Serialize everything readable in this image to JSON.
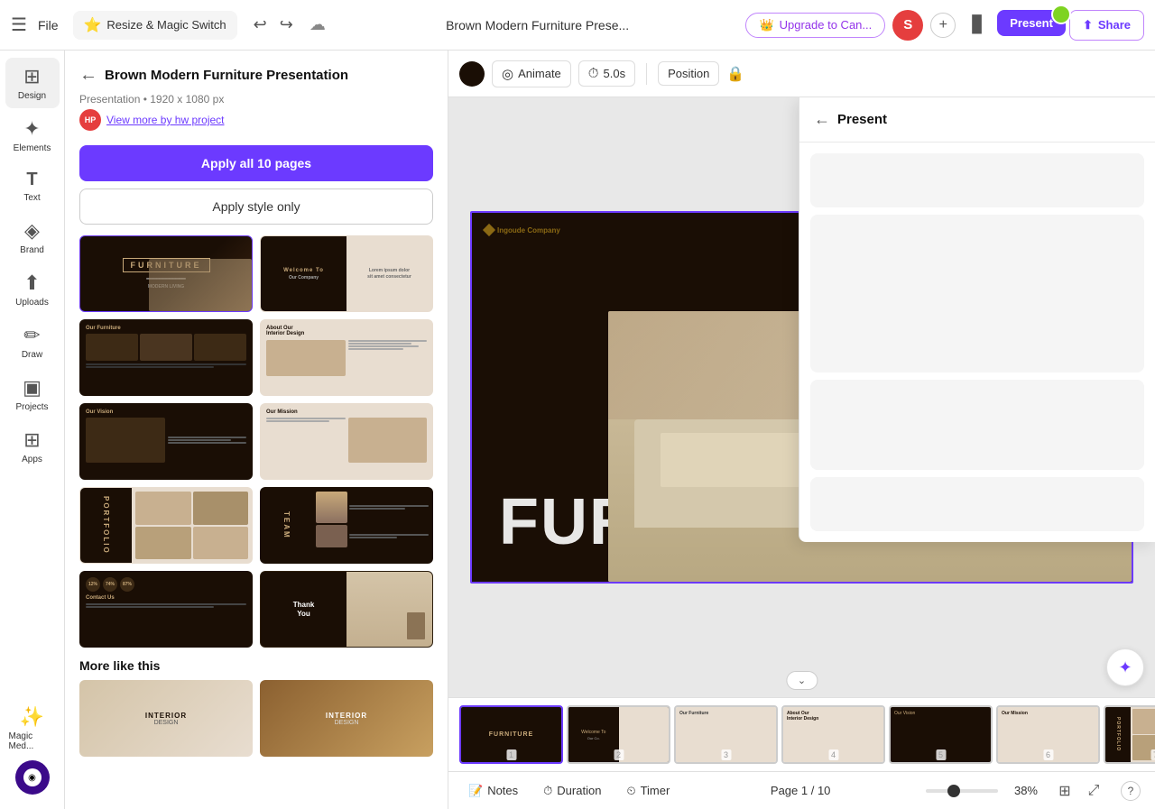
{
  "topbar": {
    "menu_icon": "☰",
    "file_label": "File",
    "magic_switch_icon": "⭐",
    "magic_switch_label": "Resize & Magic Switch",
    "undo_icon": "↩",
    "redo_icon": "↪",
    "cloud_icon": "☁",
    "title": "Brown Modern Furniture Prese...",
    "upgrade_icon": "👑",
    "upgrade_label": "Upgrade to Can...",
    "avatar_label": "S",
    "plus_label": "+",
    "bars_icon": "▊",
    "present_label": "Present",
    "share_icon": "⬆",
    "share_label": "Share"
  },
  "sidebar": {
    "items": [
      {
        "icon": "⊞",
        "label": "Design"
      },
      {
        "icon": "✦",
        "label": "Elements"
      },
      {
        "icon": "T",
        "label": "Text"
      },
      {
        "icon": "◈",
        "label": "Brand"
      },
      {
        "icon": "⬆",
        "label": "Uploads"
      },
      {
        "icon": "✏",
        "label": "Draw"
      },
      {
        "icon": "▣",
        "label": "Projects"
      },
      {
        "icon": "⊞",
        "label": "Apps"
      }
    ],
    "magic_media_label": "Magic Med..."
  },
  "left_panel": {
    "back_icon": "←",
    "title": "Brown Modern Furniture Presentation",
    "subtitle": "Presentation • 1920 x 1080 px",
    "author_label": "View more by hw project",
    "apply_all_label": "Apply all 10 pages",
    "apply_style_label": "Apply style only",
    "more_like_this_label": "More like this",
    "templates": [
      {
        "id": 1,
        "style": "th-1",
        "label": "FURNITURE"
      },
      {
        "id": 2,
        "style": "th-2",
        "label": "Welcome"
      },
      {
        "id": 3,
        "style": "th-3",
        "label": "Our Furniture"
      },
      {
        "id": 4,
        "style": "th-4",
        "label": "About"
      },
      {
        "id": 5,
        "style": "th-5",
        "label": "Our Vision"
      },
      {
        "id": 6,
        "style": "th-6",
        "label": "Our Mission"
      },
      {
        "id": 7,
        "style": "th-7",
        "label": "Portfolio"
      },
      {
        "id": 8,
        "style": "th-8",
        "label": "Team"
      },
      {
        "id": 9,
        "style": "th-9",
        "label": "Contact Us"
      },
      {
        "id": 10,
        "style": "th-10",
        "label": "Thank You"
      }
    ]
  },
  "canvas_toolbar": {
    "animate_label": "Animate",
    "duration_label": "5.0s",
    "position_label": "Position",
    "lock_icon": "🔒"
  },
  "present_panel": {
    "back_icon": "←",
    "title": "Present",
    "options": [
      {
        "id": 1,
        "size": "small"
      },
      {
        "id": 2,
        "size": "large"
      },
      {
        "id": 3,
        "size": "medium"
      },
      {
        "id": 4,
        "size": "small"
      }
    ]
  },
  "slide": {
    "logo_text": "Ingoude Company",
    "main_text": "FURN",
    "full_text": "FURNITURE"
  },
  "filmstrip": {
    "pages": [
      {
        "num": 1,
        "label": "FURNITURE",
        "style": "dark",
        "active": true
      },
      {
        "num": 2,
        "label": "",
        "style": "dark"
      },
      {
        "num": 3,
        "label": "",
        "style": "light"
      },
      {
        "num": 4,
        "label": "",
        "style": "dark"
      },
      {
        "num": 5,
        "label": "",
        "style": "dark"
      },
      {
        "num": 6,
        "label": "",
        "style": "light"
      },
      {
        "num": 7,
        "label": "",
        "style": "dark"
      }
    ]
  },
  "status_bar": {
    "notes_icon": "📝",
    "notes_label": "Notes",
    "duration_icon": "⏱",
    "duration_label": "Duration",
    "timer_icon": "⏲",
    "timer_label": "Timer",
    "page_info": "Page 1 / 10",
    "zoom_value": "38%",
    "help_label": "?"
  }
}
